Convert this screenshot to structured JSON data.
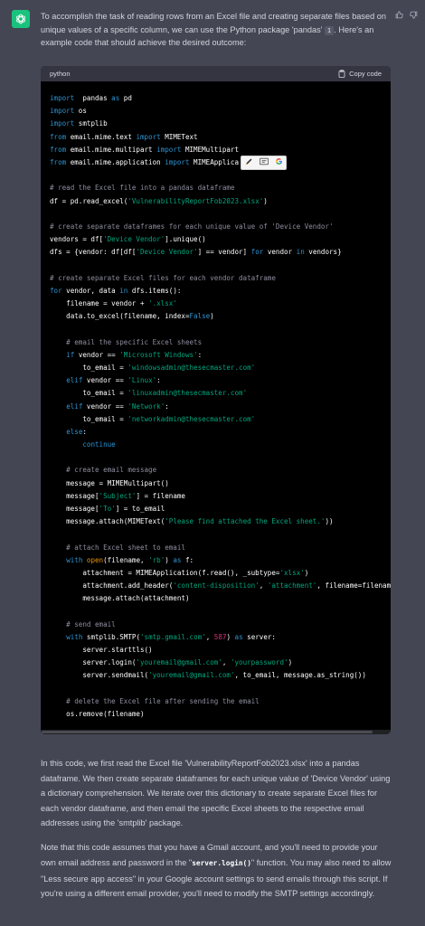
{
  "assistant": {
    "avatar_icon": "openai-logo-icon",
    "avatar_color": "#19c37d",
    "intro": [
      "To accomplish the task of reading rows from an Excel file and creating separate files based on unique values of a specific column, we can use the Python package 'pandas' ",
      "1",
      ". Here's an example code that should achieve the desired outcome:"
    ]
  },
  "actions": {
    "like_icon": "thumbs-up-icon",
    "dislike_icon": "thumbs-down-icon"
  },
  "code": {
    "language": "python",
    "copy_label": "Copy code",
    "lines": [
      [
        [
          "kw",
          "import"
        ],
        [
          "",
          "  pandas "
        ],
        [
          "kw",
          "as"
        ],
        [
          "",
          " pd"
        ]
      ],
      [
        [
          "kw",
          "import"
        ],
        [
          "",
          " os"
        ]
      ],
      [
        [
          "kw",
          "import"
        ],
        [
          "",
          " smtplib"
        ]
      ],
      [
        [
          "kw",
          "from"
        ],
        [
          "",
          " email.mime.text "
        ],
        [
          "kw",
          "import"
        ],
        [
          "",
          " MIMEText"
        ]
      ],
      [
        [
          "kw",
          "from"
        ],
        [
          "",
          " email.mime.multipart "
        ],
        [
          "kw",
          "import"
        ],
        [
          "",
          " MIMEMultipart"
        ]
      ],
      [
        [
          "kw",
          "from"
        ],
        [
          "",
          " email.mime.application "
        ],
        [
          "kw",
          "import"
        ],
        [
          "",
          " MIMEApplica"
        ]
      ],
      [],
      [
        [
          "com",
          "# read the Excel file into a pandas dataframe"
        ]
      ],
      [
        [
          "",
          "df = pd.read_excel("
        ],
        [
          "str",
          "'VulnerabilityReportFob2023.xlsx'"
        ],
        [
          "",
          ")"
        ]
      ],
      [],
      [
        [
          "com",
          "# create separate dataframes for each unique value of 'Device Vendor'"
        ]
      ],
      [
        [
          "",
          "vendors = df["
        ],
        [
          "str",
          "'Device Vendor'"
        ],
        [
          "",
          "].unique()"
        ]
      ],
      [
        [
          "",
          "dfs = {vendor: df[df["
        ],
        [
          "str",
          "'Device Vendor'"
        ],
        [
          "",
          "] == vendor] "
        ],
        [
          "kw",
          "for"
        ],
        [
          "",
          " vendor "
        ],
        [
          "kw",
          "in"
        ],
        [
          "",
          " vendors}"
        ]
      ],
      [],
      [
        [
          "com",
          "# create separate Excel files for each vendor dataframe"
        ]
      ],
      [
        [
          "kw",
          "for"
        ],
        [
          "",
          " vendor, data "
        ],
        [
          "kw",
          "in"
        ],
        [
          "",
          " dfs.items():"
        ]
      ],
      [
        [
          "",
          "    filename = vendor + "
        ],
        [
          "str",
          "'.xlsx'"
        ]
      ],
      [
        [
          "",
          "    data.to_excel(filename, index="
        ],
        [
          "kw",
          "False"
        ],
        [
          "",
          ")"
        ]
      ],
      [],
      [
        [
          "com",
          "    # email the specific Excel sheets"
        ]
      ],
      [
        [
          "",
          "    "
        ],
        [
          "kw",
          "if"
        ],
        [
          "",
          " vendor == "
        ],
        [
          "str",
          "'Microsoft Windows'"
        ],
        [
          "",
          ":"
        ]
      ],
      [
        [
          "",
          "        to_email = "
        ],
        [
          "str",
          "'windowsadmin@thesecmaster.com'"
        ]
      ],
      [
        [
          "",
          "    "
        ],
        [
          "kw",
          "elif"
        ],
        [
          "",
          " vendor == "
        ],
        [
          "str",
          "'Linux'"
        ],
        [
          "",
          ":"
        ]
      ],
      [
        [
          "",
          "        to_email = "
        ],
        [
          "str",
          "'linuxadmin@thesecmaster.com'"
        ]
      ],
      [
        [
          "",
          "    "
        ],
        [
          "kw",
          "elif"
        ],
        [
          "",
          " vendor == "
        ],
        [
          "str",
          "'Network'"
        ],
        [
          "",
          ":"
        ]
      ],
      [
        [
          "",
          "        to_email = "
        ],
        [
          "str",
          "'networkadmin@thesecmaster.com'"
        ]
      ],
      [
        [
          "",
          "    "
        ],
        [
          "kw",
          "else"
        ],
        [
          "",
          ":"
        ]
      ],
      [
        [
          "",
          "        "
        ],
        [
          "kw",
          "continue"
        ]
      ],
      [],
      [
        [
          "com",
          "    # create email message"
        ]
      ],
      [
        [
          "",
          "    message = MIMEMultipart()"
        ]
      ],
      [
        [
          "",
          "    message["
        ],
        [
          "str",
          "'Subject'"
        ],
        [
          "",
          "] = filename"
        ]
      ],
      [
        [
          "",
          "    message["
        ],
        [
          "str",
          "'To'"
        ],
        [
          "",
          "] = to_email"
        ]
      ],
      [
        [
          "",
          "    message.attach(MIMEText("
        ],
        [
          "str",
          "'Please find attached the Excel sheet.'"
        ],
        [
          "",
          "))"
        ]
      ],
      [],
      [
        [
          "com",
          "    # attach Excel sheet to email"
        ]
      ],
      [
        [
          "",
          "    "
        ],
        [
          "kw",
          "with"
        ],
        [
          "",
          " "
        ],
        [
          "bi",
          "open"
        ],
        [
          "",
          "(filename, "
        ],
        [
          "str",
          "'rb'"
        ],
        [
          "",
          ") "
        ],
        [
          "kw",
          "as"
        ],
        [
          "",
          " f:"
        ]
      ],
      [
        [
          "",
          "        attachment = MIMEApplication(f.read(), _subtype="
        ],
        [
          "str",
          "'xlsx'"
        ],
        [
          "",
          ")"
        ]
      ],
      [
        [
          "",
          "        attachment.add_header("
        ],
        [
          "str",
          "'content-disposition'"
        ],
        [
          "",
          ", "
        ],
        [
          "str",
          "'attachment'"
        ],
        [
          "",
          ", filename=filenam"
        ]
      ],
      [
        [
          "",
          "        message.attach(attachment)"
        ]
      ],
      [],
      [
        [
          "com",
          "    # send email"
        ]
      ],
      [
        [
          "",
          "    "
        ],
        [
          "kw",
          "with"
        ],
        [
          "",
          " smtplib.SMTP("
        ],
        [
          "str",
          "'smtp.gmail.com'"
        ],
        [
          "",
          ", "
        ],
        [
          "num",
          "587"
        ],
        [
          "",
          ") "
        ],
        [
          "kw",
          "as"
        ],
        [
          "",
          " server:"
        ]
      ],
      [
        [
          "",
          "        server.starttls()"
        ]
      ],
      [
        [
          "",
          "        server.login("
        ],
        [
          "str",
          "'youremail@gmail.com'"
        ],
        [
          "",
          ", "
        ],
        [
          "str",
          "'yourpassword'"
        ],
        [
          "",
          ")"
        ]
      ],
      [
        [
          "",
          "        server.sendmail("
        ],
        [
          "str",
          "'youremail@gmail.com'"
        ],
        [
          "",
          ", to_email, message.as_string())"
        ]
      ],
      [],
      [
        [
          "com",
          "    # delete the Excel file after sending the email"
        ]
      ],
      [
        [
          "",
          "    os.remove(filename)"
        ]
      ]
    ]
  },
  "popup": {
    "icons": [
      "edit-icon",
      "translate-icon",
      "google-icon"
    ]
  },
  "after": {
    "p1": "In this code, we first read the Excel file 'VulnerabilityReportFob2023.xlsx' into a pandas dataframe. We then create separate dataframes for each unique value of 'Device Vendor' using a dictionary comprehension. We iterate over this dictionary to create separate Excel files for each vendor dataframe, and then email the specific Excel sheets to the respective email addresses using the 'smtplib' package.",
    "p2_a": "Note that this code assumes that you have a Gmail account, and you'll need to provide your own email address and password in the \"",
    "p2_code": "server.login()",
    "p2_b": "\" function. You may also need to allow \"Less secure app access\" in your Google account settings to send emails through this script. If you're using a different email provider, you'll need to modify the SMTP settings accordingly."
  }
}
